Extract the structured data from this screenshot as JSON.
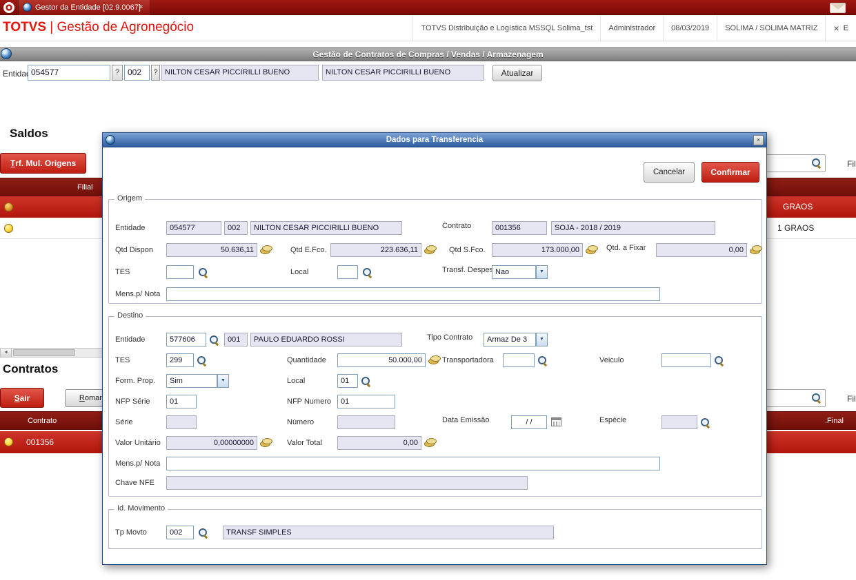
{
  "icons": {
    "close": "×",
    "dropdown": "▼",
    "help": "?",
    "scroll_left": "◄"
  },
  "tabbar": {
    "title": "Gestor da Entidade [02.9.0067]"
  },
  "header": {
    "brand_name": "TOTVS",
    "brand_rest": "| Gestão de Agronegócio",
    "env": "TOTVS Distribuição e Logística MSSQL Solima_tst",
    "user": "Administrador",
    "date": "08/03/2019",
    "company": "SOLIMA / SOLIMA MATRIZ",
    "exit_label": "E"
  },
  "toolbar": {
    "page_title": "Gestão de Contratos de Compras / Vendas / Armazenagem"
  },
  "entity_bar": {
    "label": "Entidade",
    "code": "054577",
    "store": "002",
    "name": "NILTON CESAR PICCIRILLI BUENO",
    "name_confirm": "NILTON CESAR PICCIRILLI BUENO",
    "update_btn": "Atualizar"
  },
  "saldos": {
    "title": "Saldos",
    "trf_hot": "T",
    "trf_rest": "rf. Mul. Origens",
    "filter_hint": "Fil",
    "col_filial": "Filial",
    "rows": [
      {
        "product": "GRAOS"
      },
      {
        "product": "1 GRAOS"
      }
    ]
  },
  "contratos": {
    "title": "Contratos",
    "sair_hot": "S",
    "sair_rest": "air",
    "romaneio_hot": "R",
    "romaneio_rest": "omaneio",
    "filter_hint": "Fil",
    "col_contrato": "Contrato",
    "col_final": ".Final",
    "row_contrato": "001356"
  },
  "modal": {
    "title": "Dados para Transferencia",
    "cancel": "Cancelar",
    "confirm": "Confirmar",
    "origem": {
      "legend": "Origem",
      "entidade_label": "Entidade",
      "entidade": "054577",
      "loja": "002",
      "nome": "NILTON CESAR PICCIRILLI BUENO",
      "contrato_label": "Contrato",
      "contrato": "001356",
      "contrato_desc": "SOJA  - 2018 / 2019",
      "qtd_dispon_label": "Qtd Dispon",
      "qtd_dispon": "50.636,11",
      "qtd_efco_label": "Qtd E.Fco.",
      "qtd_efco": "223.636,11",
      "qtd_sfco_label": "Qtd S.Fco.",
      "qtd_sfco": "173.000,00",
      "qtd_fixar_label": "Qtd. a Fixar",
      "qtd_fixar": "0,00",
      "tes_label": "TES",
      "tes": "",
      "local_label": "Local",
      "local": "",
      "transf_despesa_label": "Transf. Despesa",
      "transf_despesa": "Nao",
      "mens_label": "Mens.p/ Nota",
      "mens": ""
    },
    "destino": {
      "legend": "Destino",
      "entidade_label": "Entidade",
      "entidade": "577606",
      "loja": "001",
      "nome": "PAULO EDUARDO ROSSI",
      "tipo_contrato_label": "Tipo Contrato",
      "tipo_contrato": "Armaz De 3",
      "tes_label": "TES",
      "tes": "299",
      "quantidade_label": "Quantidade",
      "quantidade": "50.000,00",
      "transportadora_label": "Transportadora",
      "transportadora": "",
      "veiculo_label": "Veiculo",
      "veiculo": "",
      "form_prop_label": "Form. Prop.",
      "form_prop": "Sim",
      "local_label": "Local",
      "local": "01",
      "nfp_serie_label": "NFP Série",
      "nfp_serie": "01",
      "nfp_numero_label": "NFP Numero",
      "nfp_numero": "01",
      "serie_label": "Série",
      "serie": "",
      "numero_label": "Número",
      "numero": "",
      "data_emissao_label": "Data Emissão",
      "data_emissao": "/ /",
      "especie_label": "Espécie",
      "especie": "",
      "valor_unitario_label": "Valor Unitário",
      "valor_unitario": "0,00000000",
      "valor_total_label": "Valor Total",
      "valor_total": "0,00",
      "mens_label": "Mens.p/ Nota",
      "mens": "",
      "chave_label": "Chave NFE",
      "chave": ""
    },
    "id_movimento": {
      "legend": "Id. Movimento",
      "tp_movto_label": "Tp Movto",
      "tp_movto": "002",
      "tp_movto_desc": "TRANSF SIMPLES"
    }
  }
}
